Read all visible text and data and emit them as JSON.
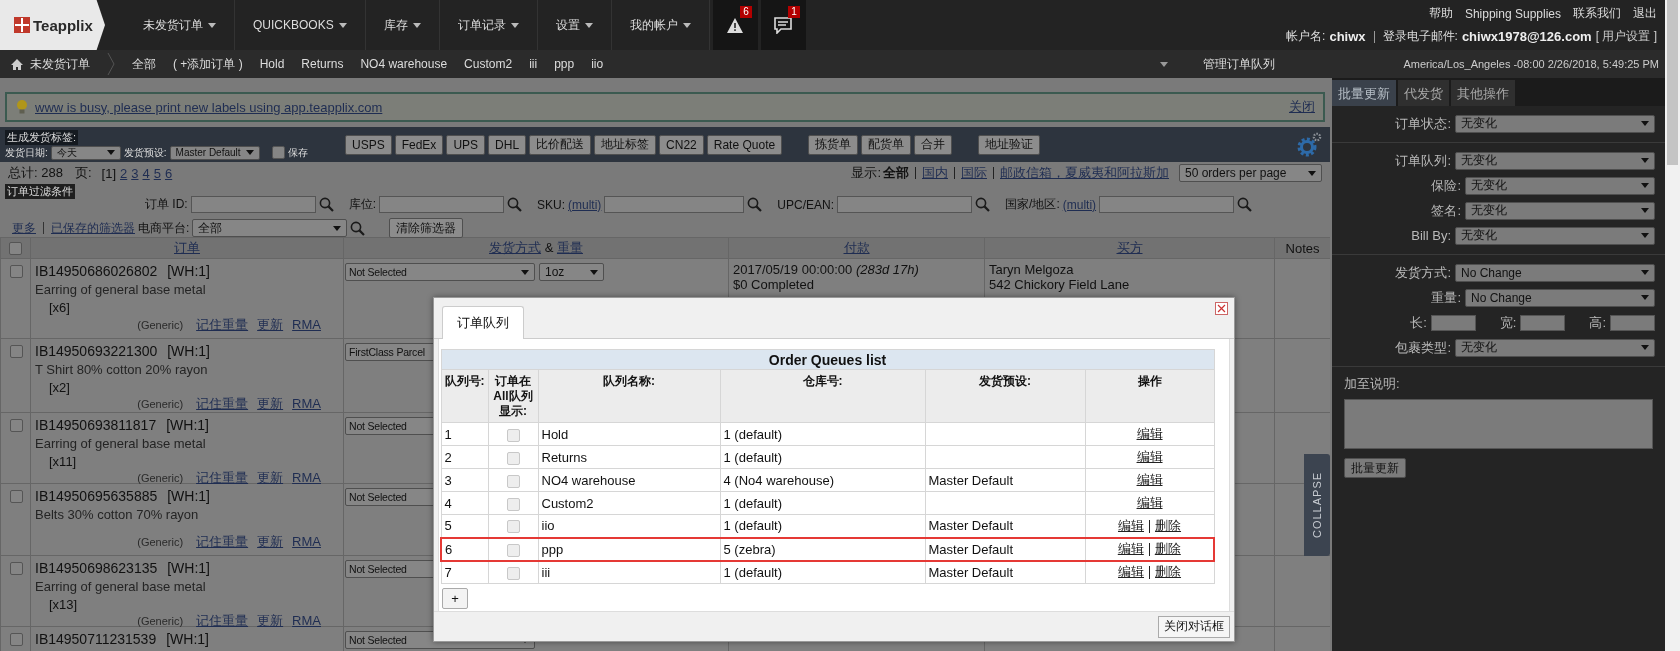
{
  "header": {
    "logo": "Teapplix",
    "nav": [
      "未发货订单",
      "QUICKBOOKS",
      "库存",
      "订单记录",
      "设置",
      "我的帐户"
    ],
    "alerts": [
      {
        "kind": "warning",
        "count": "6"
      },
      {
        "kind": "message",
        "count": "1"
      }
    ],
    "links": [
      "帮助",
      "Shipping Supplies",
      "联系我们",
      "退出"
    ],
    "account": {
      "user_label": "帐户名:",
      "user": "chiwx",
      "email_label": "登录电子邮件:",
      "email": "chiwx1978@126.com",
      "settings": "[ 用户设置 ]"
    }
  },
  "subnav": {
    "home": "未发货订单",
    "queues": [
      "全部",
      "( +添加订单 )",
      "Hold",
      "Returns",
      "NO4 warehouse",
      "Custom2",
      "iii",
      "ppp",
      "iio"
    ],
    "manage": "管理订单队列",
    "timezone": "America/Los_Angeles -08:00 2/26/2018, 5:49:25 PM"
  },
  "notice": {
    "message": "www is busy, please print new labels using app.teapplix.com",
    "close": "关闭"
  },
  "label_toolbar": {
    "title": "生成发货标签:",
    "date_label": "发货日期:",
    "date": "今天",
    "preset_label": "发货预设:",
    "preset": "Master Default",
    "save": {
      "label": "保存",
      "checked": false
    },
    "button_groups": [
      [
        "USPS",
        "FedEx",
        "UPS",
        "DHL",
        "比价配送",
        "地址标签",
        "CN22",
        "Rate Quote"
      ],
      [
        "拣货单",
        "配货单",
        "合并"
      ],
      [
        "地址验证"
      ]
    ]
  },
  "summary": {
    "total": "总计: 288",
    "page_label": "页:",
    "pages": [
      {
        "label": "[1]",
        "selected": true
      },
      {
        "label": "2",
        "selected": false
      },
      {
        "label": "3",
        "selected": false
      },
      {
        "label": "4",
        "selected": false
      },
      {
        "label": "5",
        "selected": false
      },
      {
        "label": "6",
        "selected": false
      }
    ],
    "show_label": "显示:",
    "filters": [
      {
        "label": "全部",
        "selected": true
      },
      {
        "label": "国内",
        "selected": false
      },
      {
        "label": "国际",
        "selected": false
      },
      {
        "label": "邮政信箱，夏威夷和阿拉斯加",
        "selected": false
      }
    ],
    "per_page": "50 orders per page"
  },
  "filter": {
    "title": "订单过滤条件",
    "fields": [
      {
        "label": "订单 ID:"
      },
      {
        "label": "库位:"
      },
      {
        "label": "SKU:",
        "multi": "(multi)"
      },
      {
        "label": "UPC/EAN:"
      },
      {
        "label": "国家/地区:",
        "multi": "(multi)"
      }
    ],
    "more": "更多",
    "saved": "已保存的筛选器",
    "platform_label": "电商平台:",
    "platform": "全部",
    "clear": "清除筛选器"
  },
  "orders": {
    "select_all": {
      "checked": false
    },
    "columns": {
      "order": "订单",
      "shipping": "发货方式",
      "joiner": "&",
      "weight": "重量",
      "payment": "付款",
      "buyer": "买方",
      "notes": "Notes"
    },
    "rows": [
      {
        "checked": false,
        "id": "IB14950686026802",
        "warehouse": "[WH:1]",
        "item": "Earring of general base metal",
        "qty": "[x6]",
        "source": "(Generic)",
        "actions": [
          "记住重量",
          "更新",
          "RMA"
        ],
        "shipping": "Not Selected",
        "weight": "1oz",
        "payment_date": "2017/05/19 00:00:00",
        "age": "(283d 17h)",
        "payment_status": "$0 Completed",
        "buyer": "Taryn Melgoza",
        "address": "542 Chickory Field Lane"
      },
      {
        "checked": false,
        "id": "IB14950693221300",
        "warehouse": "[WH:1]",
        "item": "T Shirt 80% cotton 20% rayon",
        "qty": "[x2]",
        "source": "(Generic)",
        "actions": [
          "记住重量",
          "更新",
          "RMA"
        ],
        "shipping": "FirstClass Parcel"
      },
      {
        "checked": false,
        "id": "IB14950693811817",
        "warehouse": "[WH:1]",
        "item": "Earring of general base metal",
        "qty": "[x11]",
        "source": "(Generic)",
        "actions": [
          "记住重量",
          "更新",
          "RMA"
        ],
        "shipping": "Not Selected"
      },
      {
        "checked": false,
        "id": "IB14950695635885",
        "warehouse": "[WH:1]",
        "item": "Belts 30% cotton 70% rayon",
        "source": "(Generic)",
        "actions": [
          "记住重量",
          "更新",
          "RMA"
        ],
        "shipping": "Not Selected"
      },
      {
        "checked": false,
        "id": "IB14950698623135",
        "warehouse": "[WH:1]",
        "item": "Earring of general base metal",
        "qty": "[x13]",
        "source": "(Generic)",
        "actions": [
          "记住重量",
          "更新",
          "RMA"
        ],
        "shipping": "Not Selected"
      },
      {
        "checked": false,
        "id": "IB14950711231539",
        "warehouse": "[WH:1]",
        "shipping": "Not Selected"
      }
    ]
  },
  "side": {
    "tabs": [
      {
        "label": "批量更新",
        "selected": true
      },
      {
        "label": "代发货",
        "selected": false
      },
      {
        "label": "其他操作",
        "selected": false
      }
    ],
    "sections": [
      [
        {
          "kind": "select",
          "label": "订单状态:",
          "value": "无变化"
        }
      ],
      [
        {
          "kind": "select",
          "label": "订单队列:",
          "value": "无变化"
        },
        {
          "kind": "select",
          "label": "保险:",
          "value": "无变化"
        },
        {
          "kind": "select",
          "label": "签名:",
          "value": "无变化"
        },
        {
          "kind": "select",
          "label": "Bill By:",
          "value": "无变化"
        }
      ],
      [
        {
          "kind": "select",
          "label": "发货方式:",
          "value": "No Change"
        },
        {
          "kind": "select",
          "label": "重量:",
          "value": "No Change"
        },
        {
          "kind": "dimensions",
          "labels": [
            "长:",
            "宽:",
            "高:"
          ]
        },
        {
          "kind": "select",
          "label": "包裹类型:",
          "value": "无变化"
        }
      ]
    ],
    "note_label": "加至说明:",
    "submit": "批量更新",
    "collapse": "COLLAPSE"
  },
  "modal": {
    "tab": "订单队列",
    "title": "Order Queues list",
    "columns": [
      "队列号:",
      "订单在All队列显示:",
      "队列名称:",
      "仓库号:",
      "发货预设:",
      "操作"
    ],
    "rows": [
      {
        "number": "1",
        "shown_in_all": false,
        "name": "Hold",
        "warehouse": "1 (default)",
        "actions": [
          "编辑"
        ],
        "highlighted": false
      },
      {
        "number": "2",
        "shown_in_all": false,
        "name": "Returns",
        "warehouse": "1 (default)",
        "actions": [
          "编辑"
        ],
        "highlighted": false
      },
      {
        "number": "3",
        "shown_in_all": false,
        "name": "NO4 warehouse",
        "warehouse": "4 (No4 warehouse)",
        "preset": "Master Default",
        "actions": [
          "编辑"
        ],
        "highlighted": false
      },
      {
        "number": "4",
        "shown_in_all": false,
        "name": "Custom2",
        "warehouse": "1 (default)",
        "actions": [
          "编辑"
        ],
        "highlighted": false
      },
      {
        "number": "5",
        "shown_in_all": false,
        "name": "iio",
        "warehouse": "1 (default)",
        "preset": "Master Default",
        "actions": [
          "编辑",
          "删除"
        ],
        "highlighted": false
      },
      {
        "number": "6",
        "shown_in_all": false,
        "name": "ppp",
        "warehouse": "5 (zebra)",
        "preset": "Master Default",
        "actions": [
          "编辑",
          "删除"
        ],
        "highlighted": true
      },
      {
        "number": "7",
        "shown_in_all": false,
        "name": "iii",
        "warehouse": "1 (default)",
        "preset": "Master Default",
        "actions": [
          "编辑",
          "删除"
        ],
        "highlighted": false
      }
    ],
    "add": "+",
    "close": "关闭对话框"
  }
}
